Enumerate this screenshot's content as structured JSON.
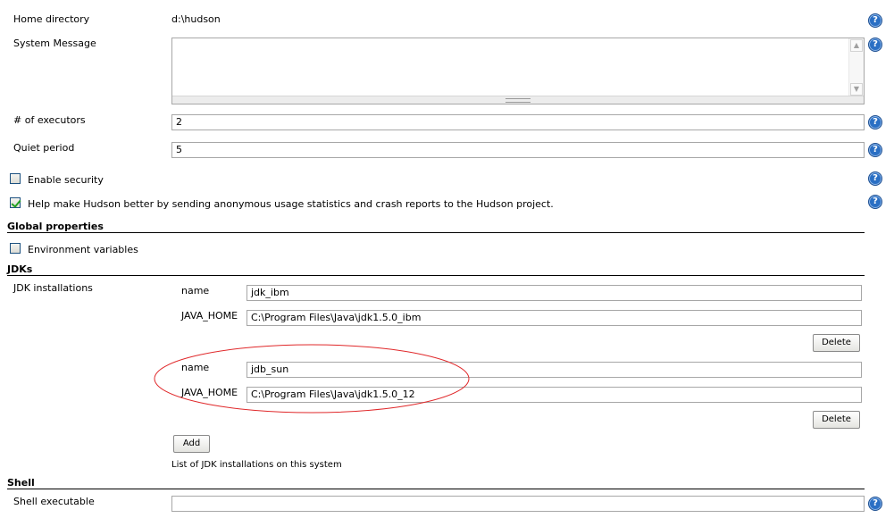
{
  "general": {
    "home_directory_label": "Home directory",
    "home_directory_value": "d:\\hudson",
    "system_message_label": "System Message",
    "system_message_value": "",
    "executors_label": "# of executors",
    "executors_value": "2",
    "quiet_period_label": "Quiet period",
    "quiet_period_value": "5",
    "enable_security_label": "Enable security",
    "enable_security_checked": false,
    "usage_stats_label": "Help make Hudson better by sending anonymous usage statistics and crash reports to the Hudson project.",
    "usage_stats_checked": true
  },
  "global_properties": {
    "title": "Global properties",
    "env_vars_label": "Environment variables",
    "env_vars_checked": false
  },
  "jdks": {
    "title": "JDKs",
    "installations_label": "JDK installations",
    "name_label": "name",
    "java_home_label": "JAVA_HOME",
    "installations": [
      {
        "name": "jdk_ibm",
        "java_home": "C:\\Program Files\\Java\\jdk1.5.0_ibm"
      },
      {
        "name": "jdb_sun",
        "java_home": "C:\\Program Files\\Java\\jdk1.5.0_12"
      }
    ],
    "delete_label": "Delete",
    "add_label": "Add",
    "description": "List of JDK installations on this system"
  },
  "shell": {
    "title": "Shell",
    "executable_label": "Shell executable",
    "executable_value": ""
  },
  "help_icon": {
    "name": "help-icon",
    "glyph": "?",
    "color": "#2a6fc4"
  },
  "annotation": {
    "color": "#e0282a"
  }
}
